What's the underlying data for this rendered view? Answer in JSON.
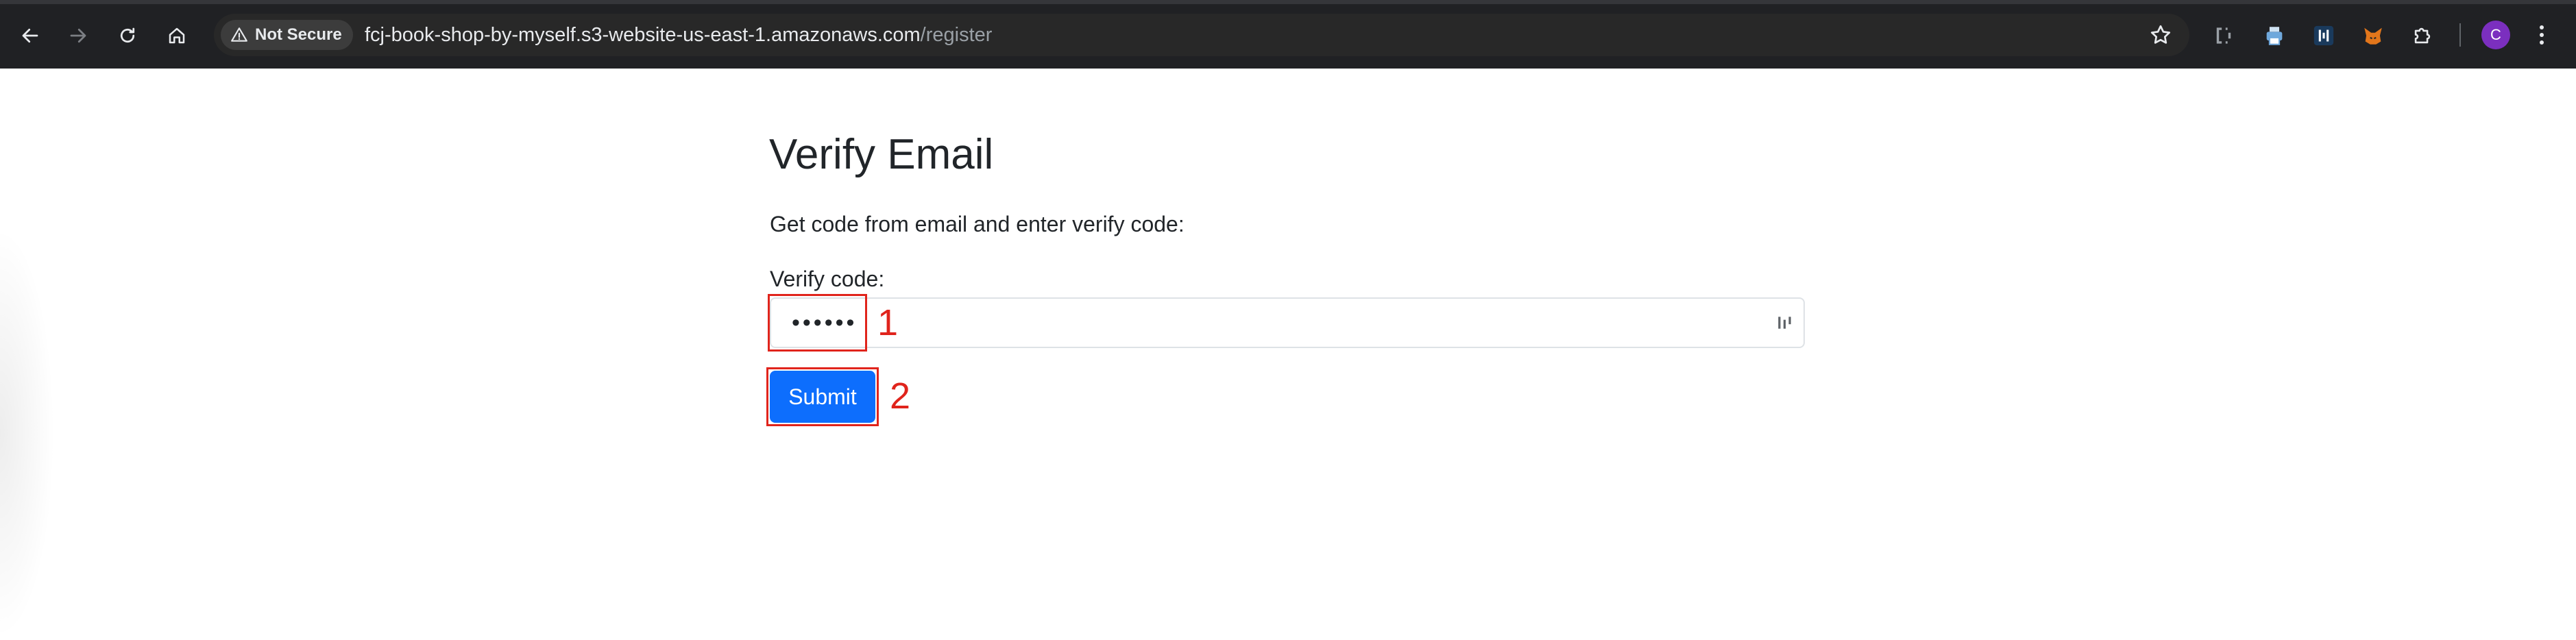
{
  "browser": {
    "security_label": "Not Secure",
    "url_host": "fcj-book-shop-by-myself.s3-website-us-east-1.amazonaws.com",
    "url_path": "/register",
    "profile_initial": "C",
    "icons": {
      "back": "arrow-left-icon",
      "forward": "arrow-right-icon",
      "reload": "reload-icon",
      "home": "home-icon",
      "warning": "warning-triangle-icon",
      "bookmark": "star-icon",
      "extensions": [
        "ci-extension-icon",
        "printer-extension-icon",
        "blue-extension-icon",
        "metamask-fox-icon",
        "puzzle-extensions-icon"
      ],
      "menu": "kebab-menu-icon"
    }
  },
  "form": {
    "title": "Verify Email",
    "instruction": "Get code from email and enter verify code:",
    "code_label": "Verify code:",
    "code_value_masked": "••••••",
    "submit_label": "Submit"
  },
  "annotations": [
    {
      "number": "1",
      "target": "verify-code-input"
    },
    {
      "number": "2",
      "target": "submit-button"
    }
  ],
  "colors": {
    "chrome_bg": "#202124",
    "omnibox_bg": "#282828",
    "primary_button": "#0d6efd",
    "annotation_red": "#e0241c",
    "avatar": "#7b2fbf"
  }
}
